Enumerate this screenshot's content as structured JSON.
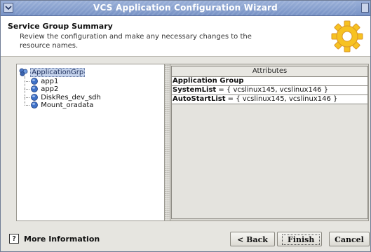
{
  "window": {
    "title": "VCS Application Configuration Wizard"
  },
  "header": {
    "title": "Service Group Summary",
    "description": "Review the configuration and make any necessary changes to the resource names.",
    "icon": "gear-icon"
  },
  "tree": {
    "root": {
      "label": "ApplicationGrp",
      "icon": "service-group-icon"
    },
    "children": [
      {
        "label": "app1",
        "icon": "resource-icon"
      },
      {
        "label": "app2",
        "icon": "resource-icon"
      },
      {
        "label": "DiskRes_dev_sdh",
        "icon": "resource-icon"
      },
      {
        "label": "Mount_oradata",
        "icon": "resource-icon"
      }
    ]
  },
  "attributes": {
    "header": "Attributes",
    "rows": [
      {
        "label": "Application Group",
        "value": ""
      },
      {
        "label": "SystemList",
        "value": " = { vcslinux145, vcslinux146 }"
      },
      {
        "label": "AutoStartList",
        "value": " = { vcslinux145, vcslinux146 }"
      }
    ]
  },
  "footer": {
    "more_info": "More Information",
    "help_glyph": "?",
    "back": "< Back",
    "finish": "Finish",
    "cancel": "Cancel"
  },
  "colors": {
    "titlebar": "#8aa3d2",
    "selection": "#c5d3ec",
    "accent": "#f5b300"
  }
}
